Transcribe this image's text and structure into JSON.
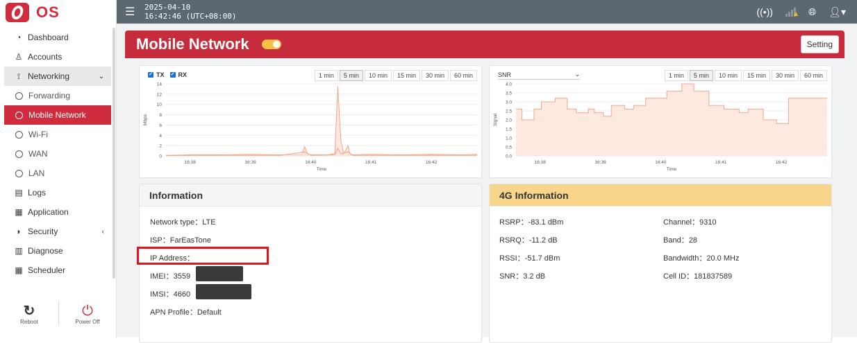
{
  "brand": {
    "name": "OS"
  },
  "sidebar": {
    "items": [
      {
        "key": "dashboard",
        "label": "Dashboard",
        "icon": "gauge-icon",
        "glyph": "◔"
      },
      {
        "key": "accounts",
        "label": "Accounts",
        "icon": "user-icon",
        "glyph": "♙"
      },
      {
        "key": "networking",
        "label": "Networking",
        "icon": "antenna-icon",
        "glyph": "⟟"
      },
      {
        "key": "forwarding",
        "label": "Forwarding"
      },
      {
        "key": "mobile-network",
        "label": "Mobile Network"
      },
      {
        "key": "wifi",
        "label": "Wi-Fi"
      },
      {
        "key": "wan",
        "label": "WAN"
      },
      {
        "key": "lan",
        "label": "LAN"
      },
      {
        "key": "logs",
        "label": "Logs",
        "icon": "file-icon",
        "glyph": "▤"
      },
      {
        "key": "application",
        "label": "Application",
        "icon": "grid-icon",
        "glyph": "▦"
      },
      {
        "key": "security",
        "label": "Security",
        "icon": "shield-icon",
        "glyph": "◗"
      },
      {
        "key": "diagnose",
        "label": "Diagnose",
        "icon": "chart-icon",
        "glyph": "▥"
      },
      {
        "key": "scheduler",
        "label": "Scheduler",
        "icon": "calendar-icon",
        "glyph": "▦"
      }
    ],
    "reboot_label": "Reboot",
    "power_label": "Power Off"
  },
  "topbar": {
    "date": "2025-04-10",
    "time": "16:42:46 (UTC+08:00)"
  },
  "page": {
    "title": "Mobile Network",
    "setting_label": "Setting"
  },
  "ranges": [
    "1 min",
    "5 min",
    "10 min",
    "15 min",
    "30 min",
    "60 min"
  ],
  "selected_range": "5 min",
  "traffic": {
    "tx_label": "TX",
    "rx_label": "RX"
  },
  "snr_select": {
    "value": "SNR"
  },
  "info": {
    "title": "Information",
    "network_type": "Network type：LTE",
    "isp": "ISP：FarEasTone",
    "ip": "IP Address：",
    "imei": "IMEI：3559",
    "imsi": "IMSI：4660",
    "apn": "APN Profile：Default"
  },
  "info4g": {
    "title": "4G Information",
    "rsrp": "RSRP：-83.1 dBm",
    "rsrq": "RSRQ：-11.2 dB",
    "rssi": "RSSI：-51.7 dBm",
    "snr": "SNR：3.2 dB",
    "channel": "Channel：9310",
    "band": "Band：28",
    "bandwidth": "Bandwidth：20.0 MHz",
    "cell_id": "Cell ID：181837589"
  },
  "chart_data": [
    {
      "type": "area",
      "xlabel": "Time",
      "ylabel": "Mbps",
      "ylim": [
        0,
        14
      ],
      "yticks": [
        0,
        2,
        4,
        6,
        8,
        10,
        12,
        14
      ],
      "xticks": [
        "16:38",
        "16:39",
        "16:40",
        "16:41",
        "16:42"
      ],
      "xrange_min": [
        37.6,
        42.76
      ],
      "series": [
        {
          "name": "TX",
          "x": [
            37.6,
            38.0,
            38.5,
            39.0,
            39.5,
            39.85,
            39.9,
            39.95,
            40.0,
            40.3,
            40.4,
            40.45,
            40.5,
            40.55,
            40.62,
            40.65,
            40.7,
            41.0,
            41.5,
            42.0,
            42.5,
            42.76
          ],
          "y": [
            0.1,
            0.2,
            0.2,
            0.3,
            0.2,
            0.2,
            1.8,
            0.3,
            0.2,
            0.2,
            0.5,
            13.5,
            3.0,
            0.4,
            2.0,
            0.3,
            0.2,
            0.3,
            0.2,
            0.3,
            0.2,
            0.3
          ]
        },
        {
          "name": "RX",
          "x": [
            37.6,
            38.0,
            38.5,
            39.0,
            39.5,
            39.9,
            40.0,
            40.4,
            40.45,
            40.5,
            40.62,
            40.7,
            41.0,
            41.5,
            42.0,
            42.5,
            42.76
          ],
          "y": [
            0.05,
            0.1,
            0.1,
            0.1,
            0.1,
            0.8,
            0.1,
            0.2,
            1.5,
            0.4,
            0.8,
            0.1,
            0.1,
            0.1,
            0.1,
            0.1,
            0.1
          ]
        }
      ]
    },
    {
      "type": "area",
      "xlabel": "Time",
      "ylabel": "Signal",
      "ylim": [
        0,
        4.0
      ],
      "yticks": [
        0,
        0.5,
        1.0,
        1.5,
        2.0,
        2.5,
        3.0,
        3.5,
        4.0
      ],
      "xticks": [
        "16:38",
        "16:39",
        "16:40",
        "16:41",
        "16:42"
      ],
      "xrange_min": [
        37.6,
        42.76
      ],
      "series": [
        {
          "name": "SNR",
          "x": [
            37.6,
            37.7,
            37.7,
            37.9,
            37.9,
            38.02,
            38.02,
            38.25,
            38.25,
            38.45,
            38.45,
            38.6,
            38.6,
            38.8,
            38.8,
            38.9,
            38.9,
            39.05,
            39.05,
            39.18,
            39.18,
            39.4,
            39.4,
            39.55,
            39.55,
            39.75,
            39.75,
            40.1,
            40.1,
            40.35,
            40.35,
            40.55,
            40.55,
            40.8,
            40.8,
            41.05,
            41.05,
            41.3,
            41.3,
            41.45,
            41.45,
            41.7,
            41.7,
            41.92,
            41.92,
            42.12,
            42.12,
            42.25,
            42.25,
            42.76
          ],
          "y": [
            2.6,
            2.6,
            2.0,
            2.0,
            2.6,
            2.6,
            3.0,
            3.0,
            3.2,
            3.2,
            2.6,
            2.6,
            2.4,
            2.4,
            2.6,
            2.6,
            2.4,
            2.4,
            2.2,
            2.2,
            2.8,
            2.8,
            2.6,
            2.6,
            2.8,
            2.8,
            3.2,
            3.2,
            3.6,
            3.6,
            4.0,
            4.0,
            3.6,
            3.6,
            2.8,
            2.8,
            2.6,
            2.6,
            2.4,
            2.4,
            2.6,
            2.6,
            2.0,
            2.0,
            1.8,
            1.8,
            3.2,
            3.2,
            3.2,
            3.2
          ]
        }
      ]
    }
  ],
  "colors": {
    "brand_red": "#cf2d3d",
    "topbar": "#5c6770",
    "yellow_head": "#f7d68b",
    "chart_line": "#f2a58b",
    "chart_fill": "#fde3d8"
  }
}
